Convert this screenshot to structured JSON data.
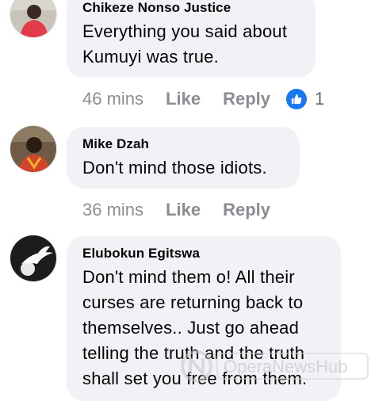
{
  "comments": [
    {
      "author": "Chikeze Nonso Justice",
      "text": "Everything you said about Kumuyi was true.",
      "time": "46 mins",
      "like_label": "Like",
      "reply_label": "Reply",
      "reaction_count": "1"
    },
    {
      "author": "Mike Dzah",
      "text": "Don't mind those idiots.",
      "time": "36 mins",
      "like_label": "Like",
      "reply_label": "Reply"
    },
    {
      "author": "Elubokun Egitswa",
      "text": "Don't mind them o! All their curses are returning back to themselves.. Just go ahead telling the truth and the truth shall set you free from them."
    }
  ],
  "watermark": {
    "text": "OperaNewsHub"
  },
  "colors": {
    "bubble": "#f0f2f5",
    "meta": "#8a8d91",
    "like_badge": "#1877f2"
  },
  "icons": {
    "reaction": "like-thumb-icon",
    "watermark": "opera-news-logo-icon"
  }
}
